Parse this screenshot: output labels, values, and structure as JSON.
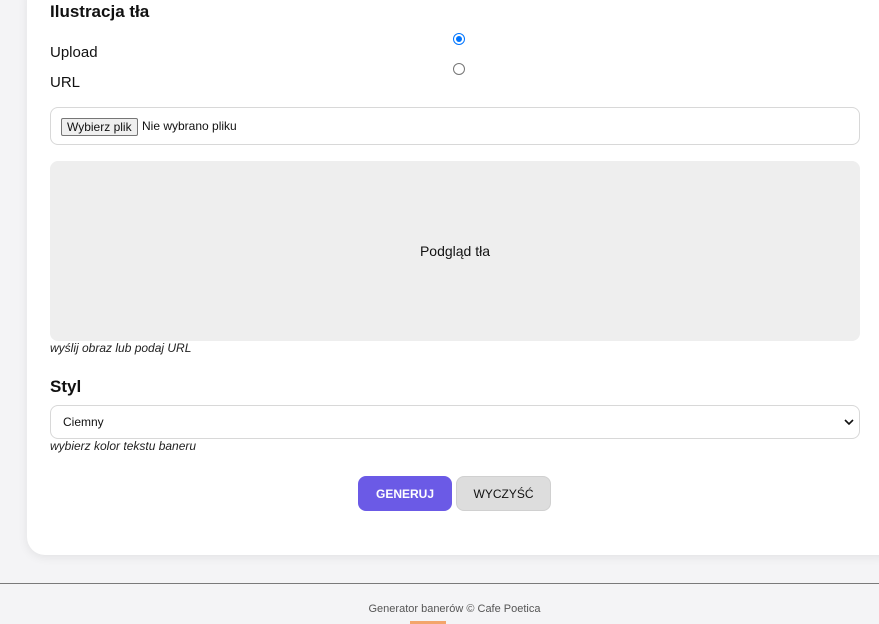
{
  "background_section": {
    "title": "Ilustracja tła",
    "options": [
      {
        "label": "Upload",
        "checked": true
      },
      {
        "label": "URL",
        "checked": false
      }
    ],
    "file_button_label": "Wybierz plik",
    "file_status": "Nie wybrano pliku",
    "preview_label": "Podgląd tła",
    "hint": "wyślij obraz lub podaj URL"
  },
  "style_section": {
    "title": "Styl",
    "selected_value": "Ciemny",
    "hint": "wybierz kolor tekstu baneru"
  },
  "actions": {
    "generate_label": "GENERUJ",
    "clear_label": "WYCZYŚĆ"
  },
  "footer": {
    "text": "Generator banerów © Cafe Poetica"
  },
  "colors": {
    "accent": "#6b5ae6",
    "radio_checked": "#0075ff"
  }
}
